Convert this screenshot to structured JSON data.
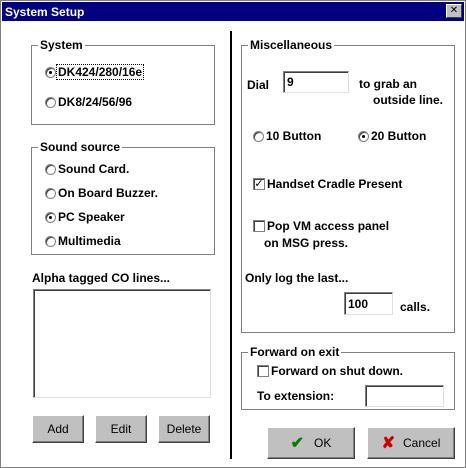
{
  "window": {
    "title": "System Setup",
    "close_glyph": "✕"
  },
  "system": {
    "title": "System",
    "options": [
      {
        "label": "DK424/280/16e",
        "selected": true
      },
      {
        "label": "DK8/24/56/96",
        "selected": false
      }
    ]
  },
  "sound": {
    "title": "Sound source",
    "options": [
      {
        "label": "Sound Card.",
        "selected": false
      },
      {
        "label": "On Board Buzzer.",
        "selected": false
      },
      {
        "label": "PC Speaker",
        "selected": true
      },
      {
        "label": "Multimedia",
        "selected": false
      }
    ]
  },
  "alpha": {
    "title": "Alpha tagged CO lines...",
    "buttons": {
      "add": "Add",
      "edit": "Edit",
      "delete": "Delete"
    }
  },
  "misc": {
    "title": "Miscellaneous",
    "dial_label": "Dial",
    "dial_value": "9",
    "dial_suffix_1": "to grab an",
    "dial_suffix_2": "outside line.",
    "button_options": [
      {
        "label": "10 Button",
        "selected": false
      },
      {
        "label": "20 Button",
        "selected": true
      }
    ],
    "handset_label": "Handset Cradle Present",
    "handset_checked": true,
    "popvm_label_1": "Pop VM access panel",
    "popvm_label_2": "on MSG press.",
    "popvm_checked": false,
    "log_label": "Only log the last...",
    "log_value": "100",
    "log_suffix": "calls."
  },
  "forward": {
    "title": "Forward on exit",
    "checkbox_label": "Forward on shut down.",
    "checked": false,
    "ext_label": "To extension:",
    "ext_value": ""
  },
  "dialog_buttons": {
    "ok": "OK",
    "cancel": "Cancel"
  },
  "icons": {
    "ok": "checkmark-icon",
    "cancel": "x-icon",
    "check_glyph": "✔",
    "x_glyph": "✘",
    "checkbox_glyph": "✓"
  }
}
